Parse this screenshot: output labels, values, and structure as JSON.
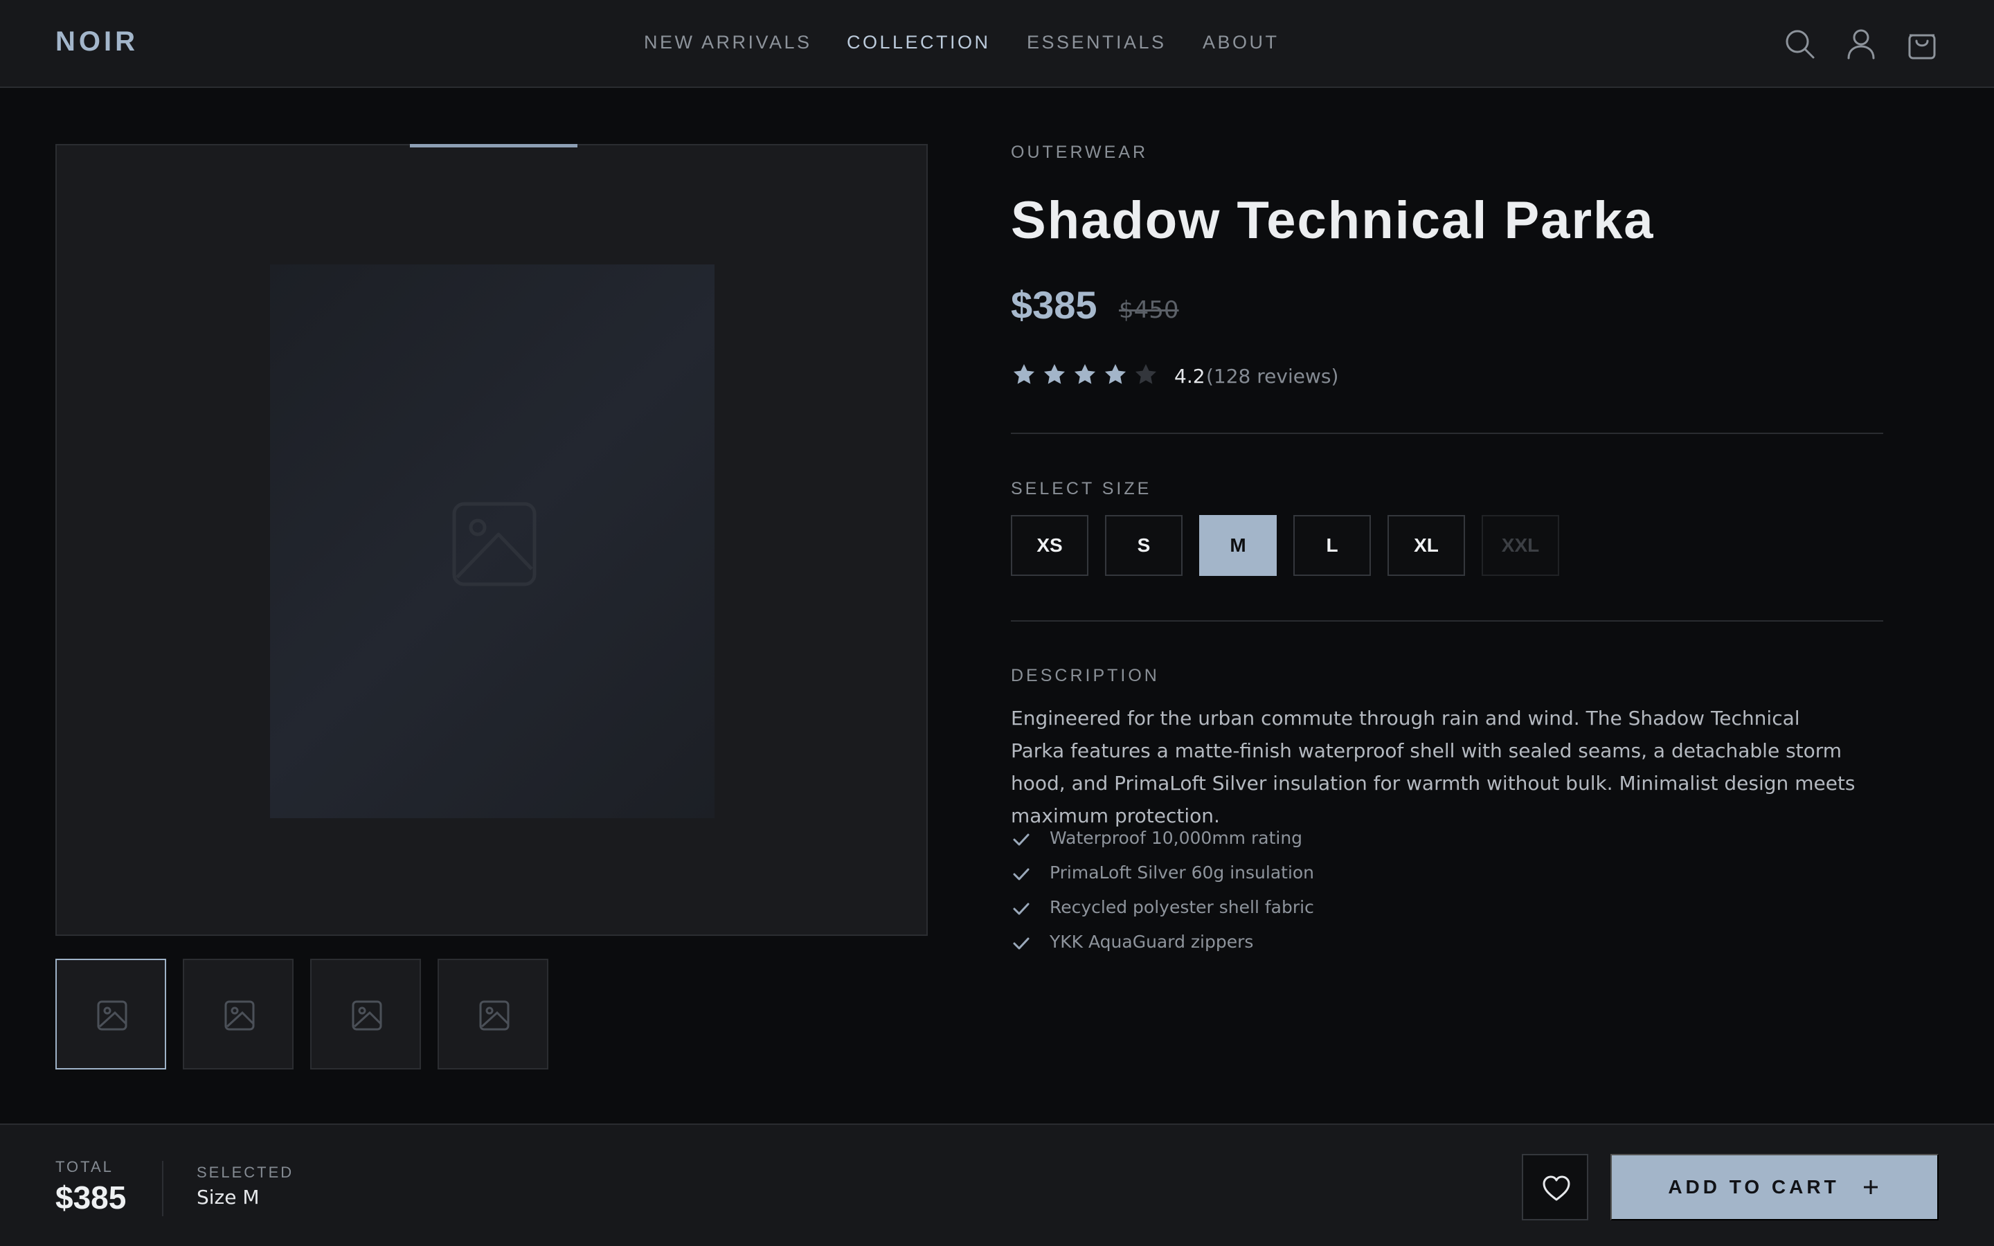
{
  "header": {
    "logo": "NOIR",
    "nav": [
      {
        "label": "NEW ARRIVALS",
        "active": false
      },
      {
        "label": "COLLECTION",
        "active": true
      },
      {
        "label": "ESSENTIALS",
        "active": false
      },
      {
        "label": "ABOUT",
        "active": false
      }
    ],
    "icons": [
      "search-icon",
      "user-icon",
      "shopping-bag-icon"
    ]
  },
  "gallery": {
    "thumbnails": [
      {
        "icon": "image-icon",
        "active": true
      },
      {
        "icon": "image-icon",
        "active": false
      },
      {
        "icon": "image-icon",
        "active": false
      },
      {
        "icon": "image-icon",
        "active": false
      }
    ]
  },
  "product": {
    "category": "OUTERWEAR",
    "title": "Shadow Technical Parka",
    "price": "$385",
    "old_price": "$450",
    "rating": {
      "value": "4.2",
      "count": "(128 reviews)",
      "stars_filled": 4,
      "stars_total": 5
    },
    "size_label": "SELECT SIZE",
    "sizes": [
      {
        "label": "XS",
        "state": "available"
      },
      {
        "label": "S",
        "state": "available"
      },
      {
        "label": "M",
        "state": "selected"
      },
      {
        "label": "L",
        "state": "available"
      },
      {
        "label": "XL",
        "state": "available"
      },
      {
        "label": "XXL",
        "state": "unavailable"
      }
    ],
    "description_label": "DESCRIPTION",
    "description": "Engineered for the urban commute through rain and wind. The Shadow Technical Parka features a matte-finish waterproof shell with sealed seams, a detachable storm hood, and PrimaLoft Silver insulation for warmth without bulk. Minimalist design meets maximum protection.",
    "features": [
      "Waterproof 10,000mm rating",
      "PrimaLoft Silver 60g insulation",
      "Recycled polyester shell fabric",
      "YKK AquaGuard zippers"
    ]
  },
  "footer": {
    "total_label": "TOTAL",
    "total_value": "$385",
    "selected_label": "SELECTED",
    "selected_value": "Size M",
    "add_to_cart_label": "ADD TO CART",
    "wishlist_icon": "heart-icon",
    "add_icon": "plus-icon"
  },
  "colors": {
    "accent": "#a3b5c9",
    "background": "#0b0c0e",
    "surface": "#17181b"
  }
}
